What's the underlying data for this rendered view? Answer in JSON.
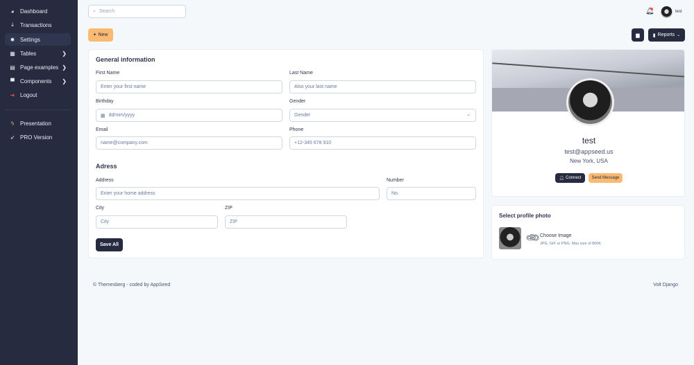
{
  "sidebar": {
    "items": [
      {
        "label": "Dashboard",
        "icon": "pie-chart-icon"
      },
      {
        "label": "Transactions",
        "icon": "hand-holding-dollar-icon"
      },
      {
        "label": "Settings",
        "icon": "gear-icon",
        "active": true
      },
      {
        "label": "Tables",
        "icon": "table-icon",
        "chevron": true
      },
      {
        "label": "Page examples",
        "icon": "file-icon",
        "chevron": true
      },
      {
        "label": "Components",
        "icon": "box-icon",
        "chevron": true
      },
      {
        "label": "Logout",
        "icon": "sign-out-icon"
      }
    ],
    "extra": [
      {
        "label": "Presentation",
        "icon": "bolt-icon"
      },
      {
        "label": "PRO Version",
        "icon": "rocket-icon"
      }
    ]
  },
  "topbar": {
    "search_placeholder": "Search",
    "user": "test"
  },
  "toolbar": {
    "new_label": "New",
    "reports_label": "Reports"
  },
  "form": {
    "general_title": "General information",
    "first_name": {
      "label": "First Name",
      "placeholder": "Enter your first name"
    },
    "last_name": {
      "label": "Last Name",
      "placeholder": "Also your last name"
    },
    "birthday": {
      "label": "Birthday",
      "placeholder": "dd/mm/yyyy"
    },
    "gender": {
      "label": "Gender",
      "value": "Gender"
    },
    "email": {
      "label": "Email",
      "placeholder": "name@company.com"
    },
    "phone": {
      "label": "Phone",
      "placeholder": "+12-345 678 910"
    },
    "address_title": "Adress",
    "address": {
      "label": "Address",
      "placeholder": "Enter your home address"
    },
    "number": {
      "label": "Number",
      "placeholder": "No."
    },
    "city": {
      "label": "City",
      "placeholder": "City"
    },
    "zip": {
      "label": "ZIP",
      "placeholder": "ZIP"
    },
    "save_label": "Save All"
  },
  "profile": {
    "name": "test",
    "email": "test@appseed.us",
    "location": "New York, USA",
    "connect_label": "Connect",
    "message_label": "Send Message"
  },
  "photo": {
    "title": "Select profile photo",
    "choose_label": "Choose Image",
    "hint": "JPG, GIF or PNG. Max size of 800K"
  },
  "footer": {
    "left": "© Themesberg - coded by AppSeed",
    "right": "Volt Django"
  },
  "colors": {
    "sidebar": "#262b40",
    "accent": "#fbba72",
    "dark_button": "#262b40",
    "notification": "#fa5252"
  }
}
